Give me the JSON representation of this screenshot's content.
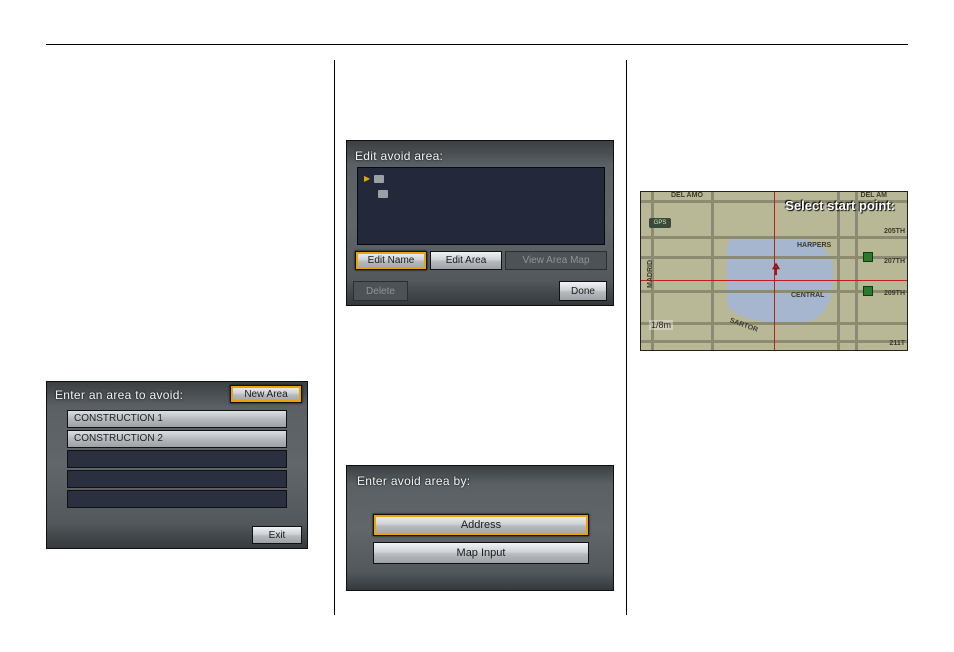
{
  "panel1": {
    "title": "Enter an area to avoid:",
    "new_area": "New Area",
    "items": [
      "CONSTRUCTION 1",
      "CONSTRUCTION 2"
    ],
    "exit": "Exit"
  },
  "panel2": {
    "title": "Edit avoid area:",
    "edit_name": "Edit Name",
    "edit_area": "Edit Area",
    "view_map": "View Area Map",
    "delete": "Delete",
    "done": "Done"
  },
  "panel3": {
    "title": "Enter avoid area by:",
    "address": "Address",
    "map_input": "Map Input"
  },
  "map": {
    "title": "Select start point:",
    "gps": "GPS",
    "scale": "1/8m",
    "labels": {
      "del_amo_l": "DEL AMO",
      "del_amo_r": "DEL AM",
      "madrid": "MADRID",
      "harpers": "HARPERS",
      "central": "CENTRAL",
      "sartor": "SARTOR",
      "r205": "205TH",
      "r207": "207TH",
      "r209": "209TH",
      "r211": "211T"
    }
  }
}
